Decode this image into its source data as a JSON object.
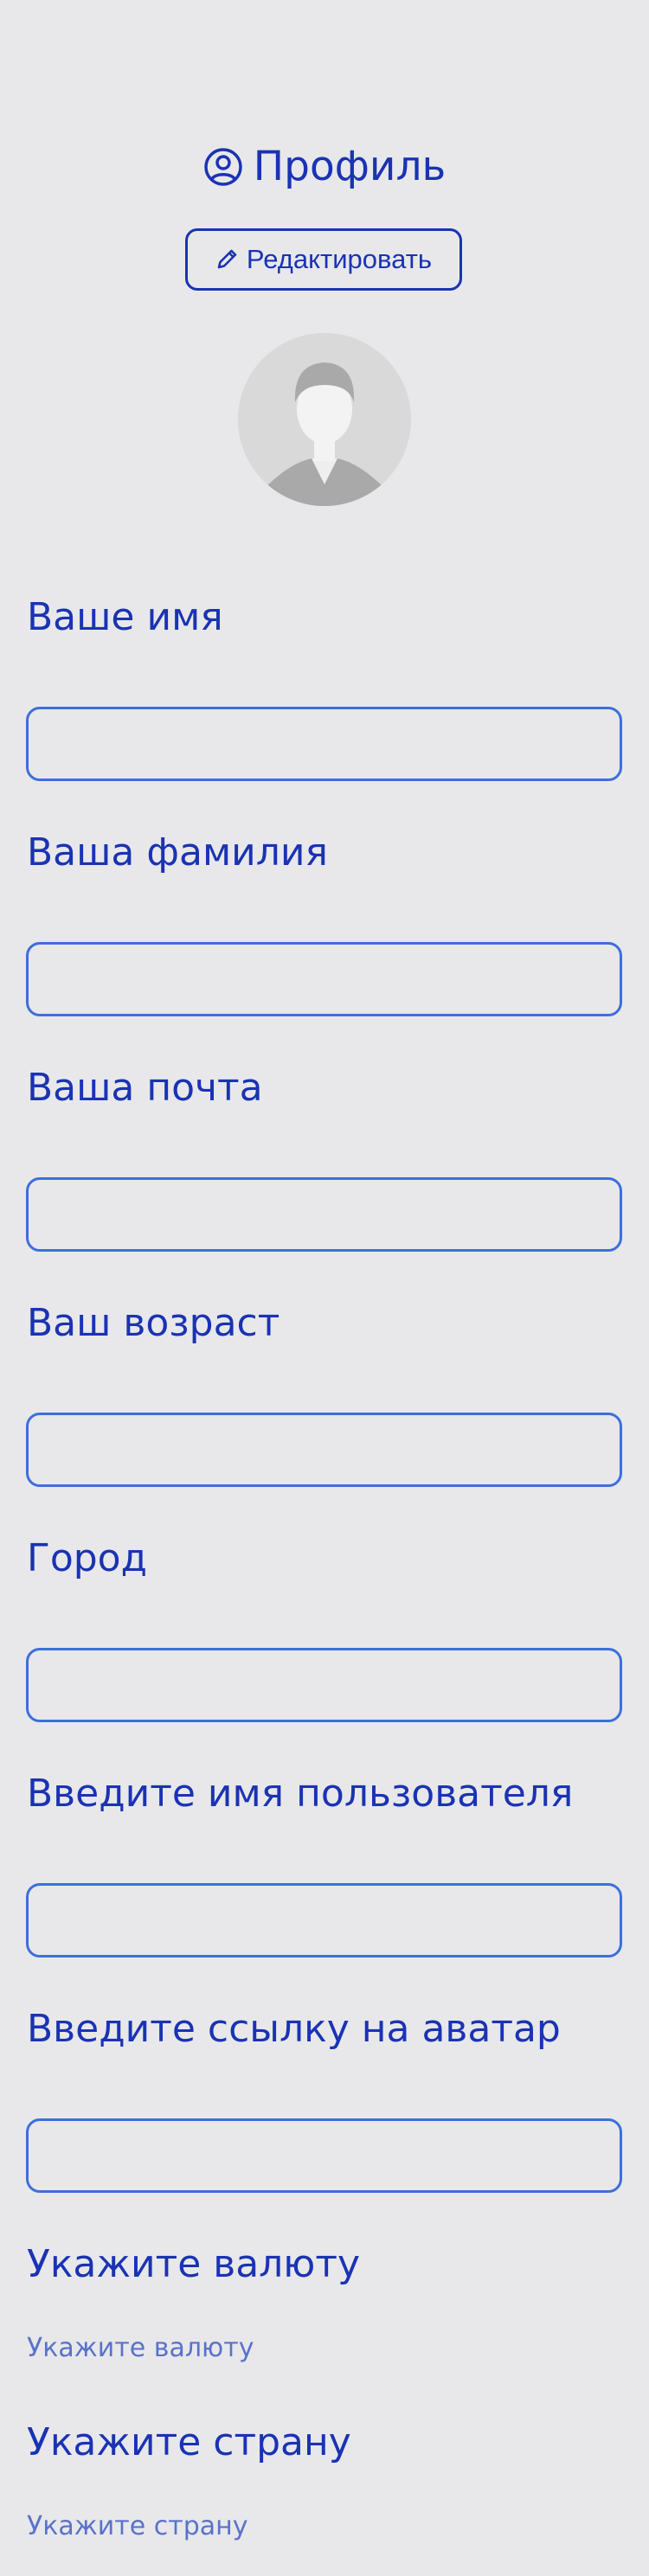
{
  "header": {
    "title": "Профиль",
    "edit_label": "Редактировать"
  },
  "colors": {
    "accent": "#1a33b3",
    "input_border": "#3d6fdb",
    "background": "#e8e8eb"
  },
  "icons": {
    "title_icon": "user-circle-icon",
    "edit_icon": "pencil-icon"
  },
  "form": {
    "fields": [
      {
        "label": "Ваше имя",
        "value": ""
      },
      {
        "label": "Ваша фамилия",
        "value": ""
      },
      {
        "label": "Ваша почта",
        "value": ""
      },
      {
        "label": "Ваш возраст",
        "value": ""
      },
      {
        "label": "Город",
        "value": ""
      },
      {
        "label": "Введите имя пользователя",
        "value": ""
      },
      {
        "label": "Введите ссылку на аватар",
        "value": ""
      }
    ],
    "currency": {
      "label": "Укажите валюту",
      "placeholder": "Укажите валюту"
    },
    "country": {
      "label": "Укажите страну",
      "placeholder": "Укажите страну"
    }
  }
}
